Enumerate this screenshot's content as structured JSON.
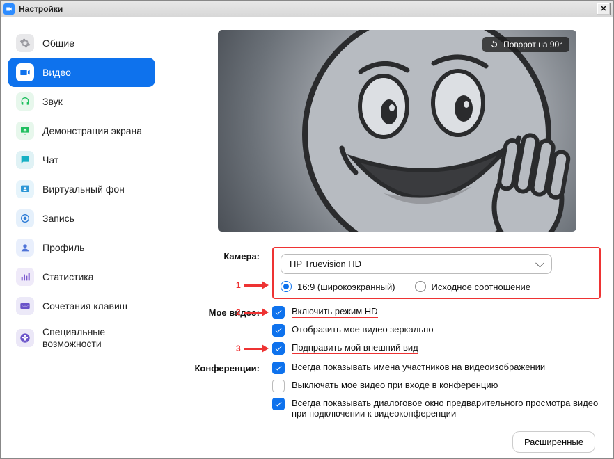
{
  "window": {
    "title": "Настройки"
  },
  "sidebar": {
    "items": [
      {
        "label": "Общие",
        "icon": "gear",
        "bg": "#e8e8ea",
        "fg": "#9a9aa0"
      },
      {
        "label": "Видео",
        "icon": "video",
        "bg": "#ffffff",
        "fg": "#0E72ED",
        "active": true
      },
      {
        "label": "Звук",
        "icon": "headphones",
        "bg": "#e7f7ec",
        "fg": "#1fbf5f"
      },
      {
        "label": "Демонстрация экрана",
        "icon": "screenshare",
        "bg": "#e7f7ec",
        "fg": "#1fbf5f"
      },
      {
        "label": "Чат",
        "icon": "chat",
        "bg": "#e0f2f5",
        "fg": "#17b0c4"
      },
      {
        "label": "Виртуальный фон",
        "icon": "background",
        "bg": "#e6f4fb",
        "fg": "#2e97d6"
      },
      {
        "label": "Запись",
        "icon": "record",
        "bg": "#e5f0fb",
        "fg": "#2e7cd6"
      },
      {
        "label": "Профиль",
        "icon": "profile",
        "bg": "#e9effc",
        "fg": "#4f74d8"
      },
      {
        "label": "Статистика",
        "icon": "stats",
        "bg": "#efeaf9",
        "fg": "#7a58cf"
      },
      {
        "label": "Сочетания клавиш",
        "icon": "keyboard",
        "bg": "#ece9f8",
        "fg": "#6a53c9"
      },
      {
        "label": "Специальные возможности",
        "icon": "accessibility",
        "bg": "#ebe7f7",
        "fg": "#6a53c9"
      }
    ]
  },
  "preview": {
    "rotate_label": "Поворот на 90°"
  },
  "sections": {
    "camera": {
      "label": "Камера:",
      "selected": "HP Truevision HD",
      "aspect": {
        "wide": "16:9 (широкоэкранный)",
        "original": "Исходное соотношение",
        "checked": "wide"
      }
    },
    "myvideo": {
      "label": "Мое видео:",
      "options": [
        {
          "label": "Включить режим HD",
          "checked": true,
          "annot": 2,
          "underline": true
        },
        {
          "label": "Отобразить мое видео зеркально",
          "checked": true
        },
        {
          "label": "Подправить мой внешний вид",
          "checked": true,
          "annot": 3,
          "underline": true
        }
      ]
    },
    "conf": {
      "label": "Конференции:",
      "options": [
        {
          "label": "Всегда показывать имена участников на видеоизображении",
          "checked": true
        },
        {
          "label": "Выключать мое видео при входе в конференцию",
          "checked": false
        },
        {
          "label": "Всегда показывать диалоговое окно предварительного просмотра видео при подключении к видеоконференции",
          "checked": true
        }
      ]
    }
  },
  "annotations": {
    "a1": "1",
    "a2": "2",
    "a3": "3"
  },
  "advanced": "Расширенные"
}
